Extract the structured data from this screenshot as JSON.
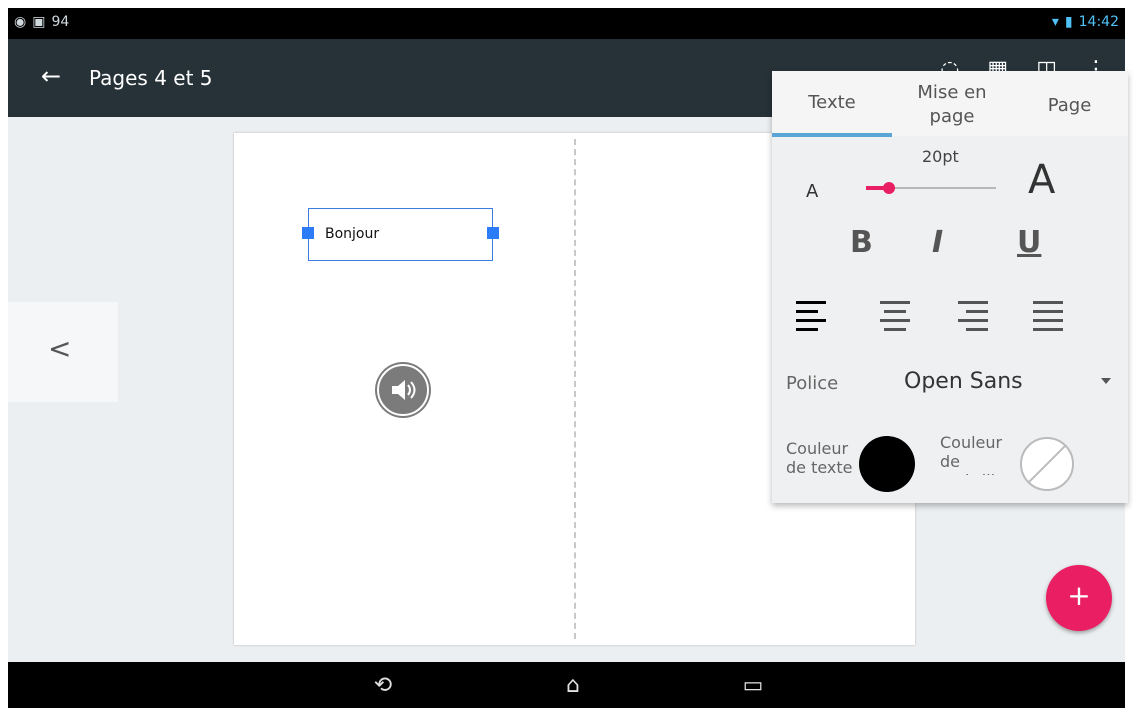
{
  "statusbar": {
    "notification_count": "94",
    "time": "14:42"
  },
  "appbar": {
    "title": "Pages 4 et 5"
  },
  "page": {
    "textbox_text": "Bonjour"
  },
  "format_panel": {
    "tabs": [
      "Texte",
      "Mise en page",
      "Page"
    ],
    "active_tab_index": 0,
    "font_size": "20pt",
    "font_size_fraction": 0.18,
    "small_a": "A",
    "large_a": "A",
    "bold": "B",
    "italic": "I",
    "underline": "U",
    "police_label": "Police",
    "font_value": "Open Sans",
    "text_color_label": "Couleur de texte",
    "text_color_value": "#000000",
    "highlight_color_label": "Couleur de surbrillance",
    "highlight_color_value": "none"
  },
  "accent_colors": {
    "appbar": "#263238",
    "fab": "#e91e63",
    "selection": "#2d7cf7"
  }
}
